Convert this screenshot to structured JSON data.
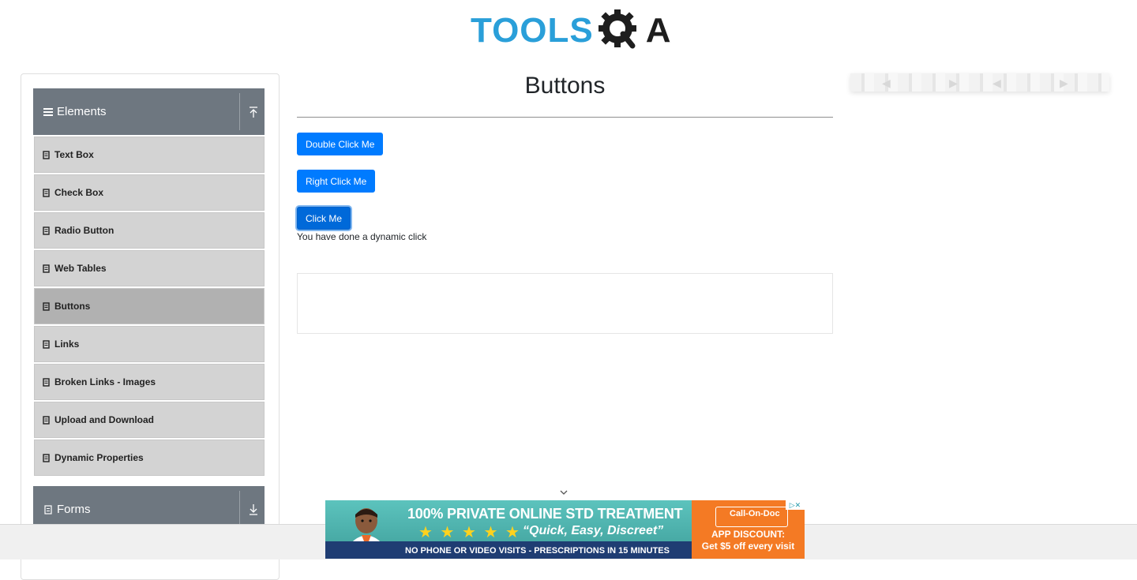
{
  "header": {
    "logo_text": "TOOLS",
    "logo_a": "A"
  },
  "sidebar": {
    "groups": [
      {
        "label": "Elements",
        "expanded": true
      },
      {
        "label": "Forms",
        "expanded": false
      }
    ],
    "items": [
      {
        "label": "Text Box"
      },
      {
        "label": "Check Box"
      },
      {
        "label": "Radio Button"
      },
      {
        "label": "Web Tables"
      },
      {
        "label": "Buttons",
        "active": true
      },
      {
        "label": "Links"
      },
      {
        "label": "Broken Links - Images"
      },
      {
        "label": "Upload and Download"
      },
      {
        "label": "Dynamic Properties"
      }
    ]
  },
  "main": {
    "title": "Buttons",
    "buttons": {
      "double_click": "Double Click Me",
      "right_click": "Right Click Me",
      "click": "Click Me"
    },
    "message": "You have done a dynamic click"
  },
  "ad": {
    "headline": "100% PRIVATE ONLINE STD TREATMENT",
    "stars": "★ ★ ★ ★ ★",
    "quote": "“Quick, Easy, Discreet”",
    "subline": "NO PHONE OR VIDEO VISITS - PRESCRIPTIONS IN 15 MINUTES",
    "brand": "Call-On-Doc",
    "discount_line1": "APP DISCOUNT:",
    "discount_line2": "Get $5 off every visit"
  },
  "colors": {
    "accent": "#007bff",
    "logo_blue": "#2a9fd9",
    "sidebar_header": "#6e7780",
    "sidebar_item": "#d3d3d3",
    "sidebar_active": "#b1b1b1"
  }
}
